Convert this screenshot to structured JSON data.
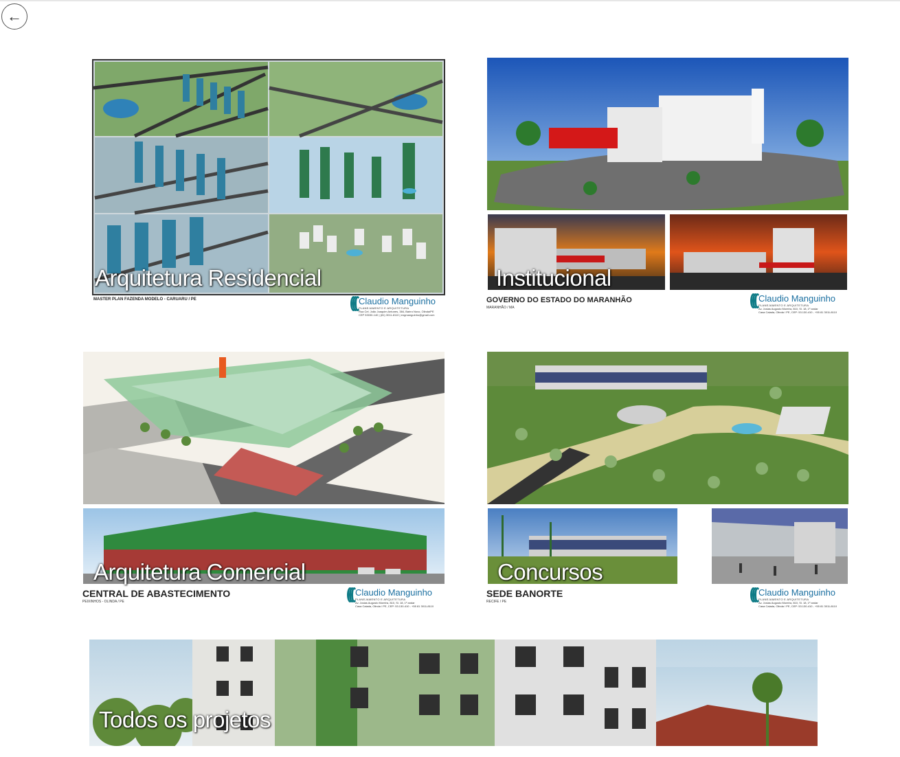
{
  "nav": {
    "back_icon": "←"
  },
  "cards": [
    {
      "caption": "Arquitetura Residencial",
      "project": "MASTER PLAN FAZENDA MODELO - CARUARU / PE",
      "logo": "Claudio Manguinho",
      "logo_tag": "PLANEJAMENTO E ARQUITETURA",
      "address1": "Rua Cel. João Joaquim Antunes, 384, Bairro Novo, Olinda/PE",
      "address2": "CEP 53030-140 | (81) 3011-8110 | engmanguinho@gmail.com"
    },
    {
      "caption": "Institucional",
      "project": "GOVERNO DO ESTADO DO MARANHÃO",
      "location": "MARANHÃO / MA",
      "logo": "Claudio Manguinho",
      "logo_tag": "PLANEJAMENTO E ARQUITETURA",
      "address1": "Av. Josias Augusto Moreira, 810, Sl. 18, 1º andar",
      "address2": "Casa Caiada, Olinda / PE, CEP: 53.130-410 - +55 81 3011-8110"
    },
    {
      "caption": "Arquitetura Comercial",
      "project": "CENTRAL DE ABASTECIMENTO",
      "location": "PEIXINHOS - OLINDA / PE",
      "logo": "Claudio Manguinho",
      "logo_tag": "PLANEJAMENTO E ARQUITETURA",
      "address1": "Av. Josias Augusto Moreira, 810, Sl. 18, 1º andar",
      "address2": "Casa Caiada, Olinda / PE, CEP: 53.130-410 - +55 81 3011-8110"
    },
    {
      "caption": "Concursos",
      "project": "SEDE BANORTE",
      "location": "RECIFE / PE",
      "logo": "Claudio Manguinho",
      "logo_tag": "PLANEJAMENTO E ARQUITETURA",
      "address1": "Av. Josias Augusto Moreira, 810, Sl. 18, 1º andar",
      "address2": "Casa Caiada, Olinda / PE, CEP: 53.130-410 - +55 81 3011-8110"
    },
    {
      "caption": "Todos os projetos"
    }
  ],
  "colors": {
    "accent": "#0e7b86",
    "logo_text": "#1a6fa0",
    "caption": "#ffffff"
  }
}
